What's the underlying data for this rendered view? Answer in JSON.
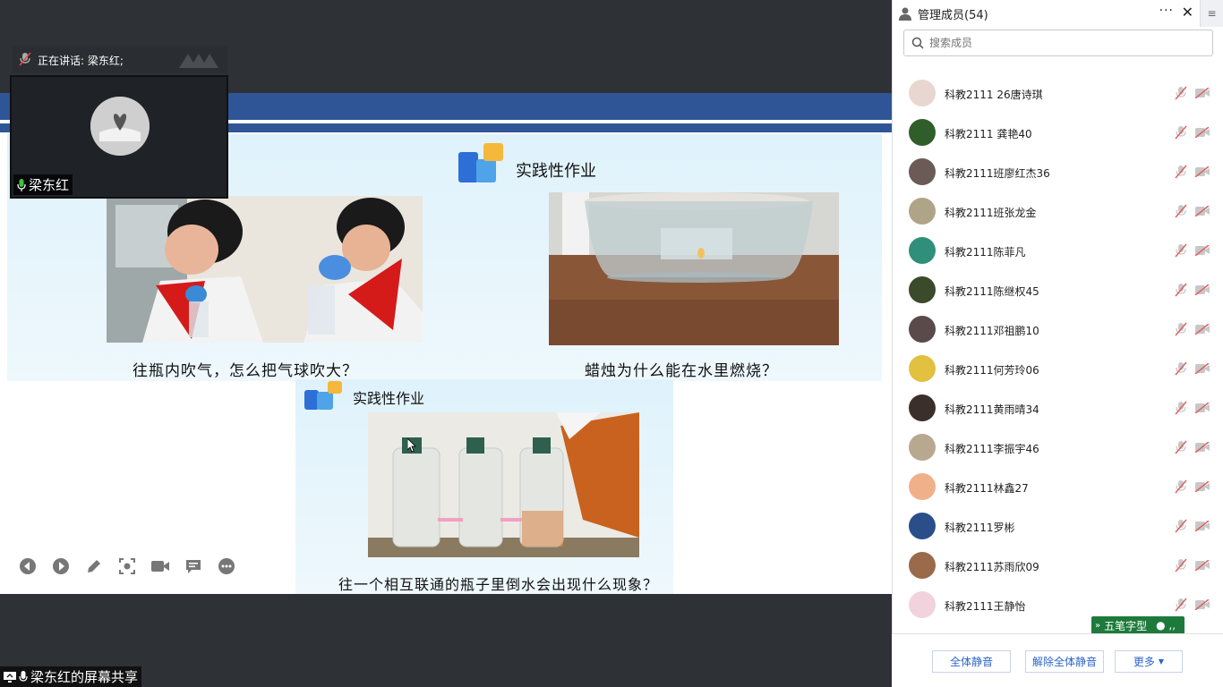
{
  "speaking": {
    "label": "正在讲话: 梁东红;"
  },
  "presenter": {
    "name": "梁东红"
  },
  "slide": {
    "title_top": "实践性作业",
    "title_bottom": "实践性作业",
    "caption_left": "往瓶内吹气，怎么把气球吹大？",
    "caption_right": "蜡烛为什么能在水里燃烧？",
    "caption_bottom": "往一个相互联通的瓶子里倒水会出现什么现象？"
  },
  "toolbar": {
    "items": [
      "prev-icon",
      "next-icon",
      "pen-icon",
      "screenshot-icon",
      "camera-icon",
      "comment-icon",
      "more-icon"
    ]
  },
  "share": {
    "label": "梁东红的屏幕共享"
  },
  "panel": {
    "title": "管理成员(54)",
    "more": "···",
    "close": "✕",
    "side": "≡",
    "search_placeholder": "搜索成员"
  },
  "members": [
    {
      "name": "科教2111 26唐诗琪",
      "avatar_color": "#e8d7d0"
    },
    {
      "name": "科教2111 龚艳40",
      "avatar_color": "#2f5e2a"
    },
    {
      "name": "科教2111班廖红杰36",
      "avatar_color": "#6b5a55"
    },
    {
      "name": "科教2111班张龙金",
      "avatar_color": "#b0a488"
    },
    {
      "name": "科教2111陈菲凡",
      "avatar_color": "#2f8f7a"
    },
    {
      "name": "科教2111陈继权45",
      "avatar_color": "#3a4a2a"
    },
    {
      "name": "科教2111邓祖鹏10",
      "avatar_color": "#5a4a4a"
    },
    {
      "name": "科教2111何芳玲06",
      "avatar_color": "#e2c040"
    },
    {
      "name": "科教2111黄雨晴34",
      "avatar_color": "#3a2f2a"
    },
    {
      "name": "科教2111李振宇46",
      "avatar_color": "#b8a890"
    },
    {
      "name": "科教2111林鑫27",
      "avatar_color": "#f0b08a"
    },
    {
      "name": "科教2111罗彬",
      "avatar_color": "#2a4e8a"
    },
    {
      "name": "科教2111苏雨欣09",
      "avatar_color": "#9a6a4a"
    },
    {
      "name": "科教2111王静怡",
      "avatar_color": "#f2d2dc"
    }
  ],
  "ime": {
    "label": "五笔字型"
  },
  "footer": {
    "mute_all": "全体静音",
    "unmute_all": "解除全体静音",
    "more": "更多"
  }
}
